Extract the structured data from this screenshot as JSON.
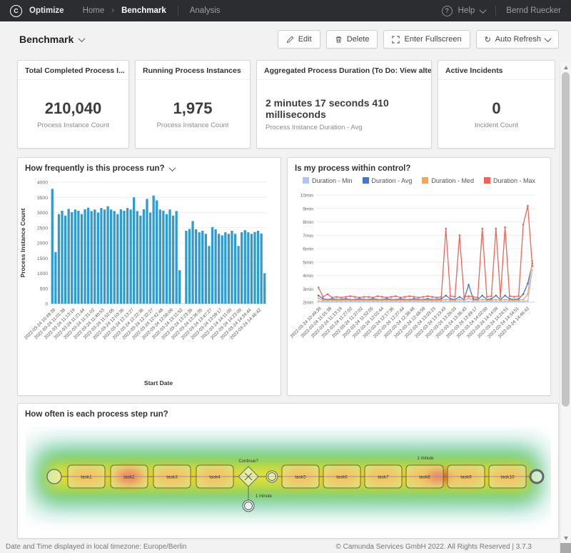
{
  "topbar": {
    "app": "Optimize",
    "home": "Home",
    "crumb_sep": "›",
    "current": "Benchmark",
    "analysis": "Analysis",
    "help": "Help",
    "user": "Bernd Ruecker",
    "logo_letter": "C"
  },
  "header": {
    "title": "Benchmark",
    "edit": "Edit",
    "delete": "Delete",
    "fullscreen": "Enter Fullscreen",
    "auto_refresh": "Auto Refresh",
    "refresh_glyph": "↻"
  },
  "kpis": [
    {
      "title": "Total Completed Process I...",
      "value": "210,040",
      "label": "Process Instance Count"
    },
    {
      "title": "Running Process Instances",
      "value": "1,975",
      "label": "Process Instance Count"
    },
    {
      "title": "Aggregated Process Duration (To Do: View alternat...",
      "value": "2 minutes 17 seconds 410 milliseconds",
      "label": "Process Instance Duration - Avg"
    },
    {
      "title": "Active Incidents",
      "value": "0",
      "label": "Incident Count"
    }
  ],
  "chart_data": [
    {
      "type": "bar",
      "title": "How frequently is this process run?",
      "xlabel": "Start Date",
      "ylabel": "Process Instance Count",
      "ylim": [
        0,
        4000
      ],
      "ytick_step": 500,
      "grid": true,
      "bar_color": "#2f9bd2",
      "x_labels": [
        "2022-03-24 10:49:39",
        "2022-03-24 11:01:38",
        "2022-03-24 11:13:19",
        "2022-03-24 11:21:44",
        "2022-03-24 11:31:02",
        "2022-03-24 11:40:53",
        "2022-03-24 11:52:05",
        "2022-03-24 12:03:36",
        "2022-03-24 12:13:27",
        "2022-03-24 12:22:36",
        "2022-03-24 12:32:27",
        "2022-03-24 12:42:48",
        "2022-03-24 12:56:09",
        "2022-03-24 13:11:52",
        "2022-03-24 13:23:35",
        "2022-03-24 13:36:35",
        "2022-03-24 13:47:27",
        "2022-03-24 13:59:17",
        "2022-03-24 14:11:00",
        "2022-03-24 14:23:00",
        "2022-03-24 14:34:44",
        "2022-03-24 14:46:42"
      ],
      "values": [
        3780,
        1700,
        2950,
        3060,
        2900,
        3120,
        3010,
        3100,
        3060,
        2950,
        3110,
        3160,
        3050,
        3100,
        3000,
        3150,
        3100,
        3210,
        3100,
        3050,
        2950,
        3110,
        3060,
        3150,
        3100,
        3500,
        3050,
        2900,
        3110,
        3450,
        3000,
        3560,
        3400,
        3100,
        3060,
        2950,
        3100,
        2900,
        3050,
        1100,
        0,
        2400,
        2460,
        2720,
        2450,
        2350,
        2400,
        2300,
        1900,
        2520,
        2450,
        2300,
        2250,
        2350,
        2300,
        2400,
        2300,
        1900,
        2350,
        2420,
        2350,
        2300,
        2360,
        2400,
        2310,
        1000
      ]
    },
    {
      "type": "line",
      "title": "Is my process within control?",
      "ylim": [
        2,
        10
      ],
      "ytick_suffix": "min",
      "grid": true,
      "legend_position": "top",
      "x_labels": [
        "2022-03-24 10:49:39",
        "2022-03-24 11:01:38",
        "2022-03-24 11:13:19",
        "2022-03-24 11:27:02",
        "2022-03-24 11:37:02",
        "2022-03-24 11:52:05",
        "2022-03-24 12:02:44",
        "2022-03-24 12:17:36",
        "2022-03-24 12:27:44",
        "2022-03-24 12:38:48",
        "2022-03-24 12:48:59",
        "2022-03-24 13:03:23",
        "2022-03-24 13:13:43",
        "2022-03-24 13:26:03",
        "2022-03-24 13:36:43",
        "2022-03-24 13:49:17",
        "2022-03-24 14:02:00",
        "2022-03-24 14:14:09",
        "2022-03-24 14:24:51",
        "2022-03-24 14:34:51",
        "2022-03-24 14:46:42"
      ],
      "series": [
        {
          "name": "Duration - Min",
          "color": "#aec6f0",
          "values": [
            2.1,
            2.05,
            2.05,
            2.05,
            2.05,
            2.05,
            2.05,
            2.05,
            2.05,
            2.05,
            2.05,
            2.05,
            2.05,
            2.05,
            2.05,
            2.05,
            2.05,
            2.05,
            2.05,
            2.05,
            2.05,
            2.05,
            2.05,
            2.05,
            2.05,
            2.05,
            2.05,
            2.05,
            2.05,
            2.05,
            2.05,
            2.05,
            2.05,
            2.05,
            2.05,
            2.05,
            2.05,
            2.05,
            2.05,
            2.05,
            2.05,
            2.05,
            2.05,
            2.05,
            2.05,
            2.05,
            2.1,
            4.4
          ]
        },
        {
          "name": "Duration - Avg",
          "color": "#4a74c4",
          "values": [
            2.5,
            2.25,
            2.2,
            2.25,
            2.2,
            2.2,
            2.25,
            2.2,
            2.2,
            2.25,
            2.2,
            2.2,
            2.25,
            2.2,
            2.2,
            2.25,
            2.2,
            2.2,
            2.25,
            2.2,
            2.2,
            2.25,
            2.2,
            2.2,
            2.25,
            2.2,
            2.2,
            2.25,
            2.5,
            2.25,
            2.2,
            2.4,
            2.2,
            3.3,
            2.25,
            2.2,
            2.5,
            2.2,
            2.25,
            2.5,
            2.2,
            2.5,
            2.25,
            2.2,
            2.25,
            2.6,
            3.4,
            4.9
          ]
        },
        {
          "name": "Duration - Med",
          "color": "#f5a45d",
          "values": [
            2.3,
            2.15,
            2.15,
            2.15,
            2.15,
            2.15,
            2.15,
            2.15,
            2.15,
            2.15,
            2.15,
            2.15,
            2.15,
            2.15,
            2.15,
            2.15,
            2.15,
            2.15,
            2.15,
            2.15,
            2.15,
            2.15,
            2.15,
            2.15,
            2.15,
            2.15,
            2.15,
            2.15,
            2.2,
            2.15,
            2.15,
            2.2,
            2.15,
            2.3,
            2.15,
            2.15,
            2.2,
            2.15,
            2.15,
            2.2,
            2.15,
            2.2,
            2.15,
            2.15,
            2.15,
            2.2,
            2.6,
            5.1
          ]
        },
        {
          "name": "Duration - Max",
          "color": "#f0635a",
          "values": [
            3.1,
            2.4,
            2.6,
            2.35,
            2.4,
            2.35,
            2.4,
            2.45,
            2.4,
            2.35,
            2.4,
            2.4,
            2.35,
            2.45,
            2.4,
            2.35,
            2.4,
            2.45,
            2.35,
            2.4,
            2.45,
            2.4,
            2.35,
            2.4,
            2.45,
            2.4,
            2.35,
            2.4,
            7.5,
            2.45,
            2.4,
            7.0,
            2.4,
            2.45,
            2.4,
            2.35,
            7.5,
            2.4,
            2.45,
            7.5,
            2.4,
            7.6,
            2.45,
            2.4,
            2.45,
            7.8,
            9.2,
            4.7
          ]
        }
      ]
    }
  ],
  "heatmap": {
    "title": "How often is each process step run?",
    "tasks": [
      "task1",
      "task2",
      "task3",
      "task4",
      "task5",
      "task6",
      "task7",
      "task8",
      "task9",
      "task10"
    ],
    "gateway_label": "Continue?",
    "branch_label": "1 minute",
    "flow_label": "1 minute",
    "heat_colors": {
      "outer": "#1fa4ae",
      "green": "#46c13e",
      "yellow": "#e6e23a",
      "orange": "#f59b23",
      "red": "#e03c20"
    }
  },
  "footer": {
    "left": "Date and Time displayed in local timezone: Europe/Berlin",
    "right": "© Camunda Services GmbH 2022. All Rights Reserved | 3.7.3"
  }
}
